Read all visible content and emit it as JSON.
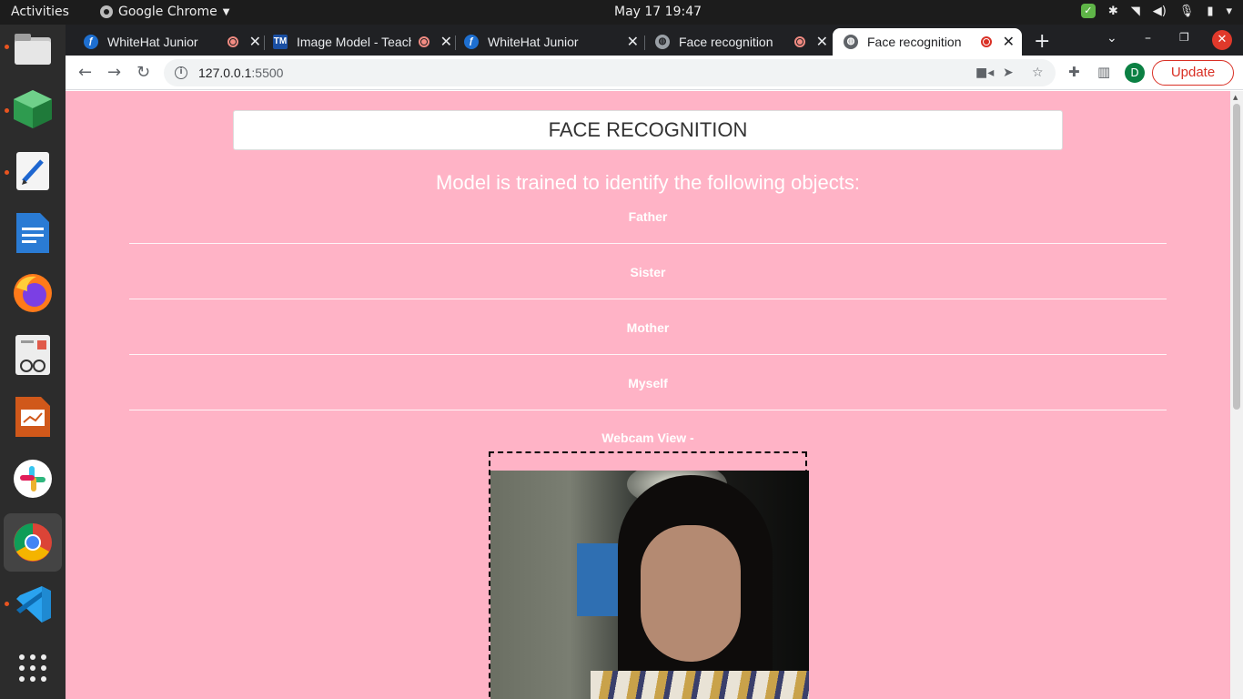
{
  "topbar": {
    "activities": "Activities",
    "app_name": "Google Chrome",
    "clock": "May 17  19:47"
  },
  "dock": {
    "apps": [
      "files-icon",
      "package-icon",
      "text-editor-icon",
      "writer-icon",
      "firefox-icon",
      "document-viewer-icon",
      "impress-icon",
      "slack-icon",
      "chrome-icon",
      "vscode-icon",
      "app-grid-icon"
    ]
  },
  "browser": {
    "tabs": [
      {
        "title": "WhiteHat Junior",
        "recording": true
      },
      {
        "title": "Image Model - Teachable Machine",
        "recording": true
      },
      {
        "title": "WhiteHat Junior",
        "recording": false
      },
      {
        "title": "Face recognition",
        "recording": true
      },
      {
        "title": "Face recognition",
        "recording": true
      }
    ],
    "url_host": "127.0.0.1",
    "url_port": ":5500",
    "profile_initial": "D",
    "update_label": "Update"
  },
  "page": {
    "title": "FACE RECOGNITION",
    "subtitle": "Model is trained to identify the following objects:",
    "objects": [
      "Father",
      "Sister",
      "Mother",
      "Myself"
    ],
    "webcam_label": "Webcam View -",
    "background_color": "#ffb3c6"
  }
}
